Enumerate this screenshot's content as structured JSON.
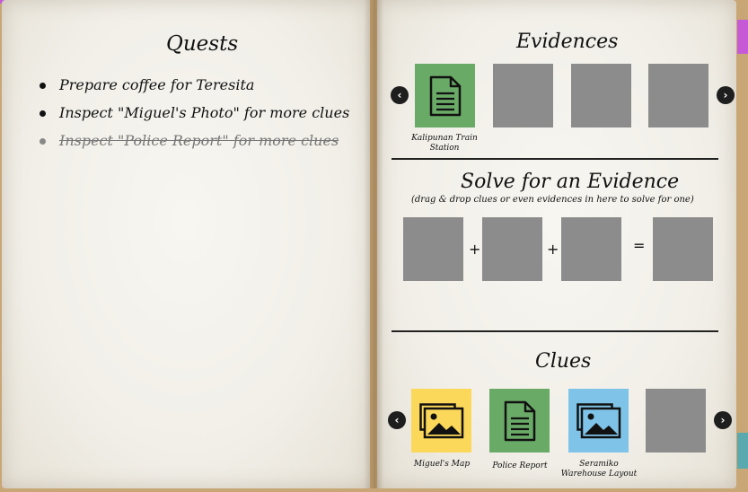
{
  "quests": {
    "title": "Quests",
    "items": [
      {
        "text": "Prepare coffee for Teresita",
        "done": false
      },
      {
        "text": "Inspect \"Miguel's Photo\" for more clues",
        "done": false
      },
      {
        "text": "Inspect \"Police Report\" for more clues",
        "done": true
      }
    ]
  },
  "evidences": {
    "title": "Evidences",
    "items": [
      {
        "label": "Kalipunan Train Station",
        "icon": "document-icon",
        "color": "#6aaa67"
      },
      {
        "label": "",
        "icon": "",
        "color": "#8c8c8c"
      },
      {
        "label": "",
        "icon": "",
        "color": "#8c8c8c"
      },
      {
        "label": "",
        "icon": "",
        "color": "#8c8c8c"
      }
    ],
    "prev": "‹",
    "next": "›"
  },
  "solve": {
    "title": "Solve for an Evidence",
    "subtitle": "(drag & drop clues or even evidences in here to solve for one)",
    "plus": "+",
    "equals": "="
  },
  "clues": {
    "title": "Clues",
    "items": [
      {
        "label": "Miguel's Map",
        "icon": "image-icon",
        "color": "#fcd85a"
      },
      {
        "label": "Police Report",
        "icon": "document-icon",
        "color": "#6aaa67"
      },
      {
        "label": "Seramiko Warehouse Layout",
        "icon": "image-icon",
        "color": "#7fc4e8"
      },
      {
        "label": "",
        "icon": "",
        "color": "#8c8c8c"
      }
    ],
    "prev": "‹",
    "next": "›"
  },
  "colors": {
    "tab_accent": "#c65ad6",
    "tab_teal": "#5aa9ae",
    "slot_empty": "#8c8c8c"
  }
}
